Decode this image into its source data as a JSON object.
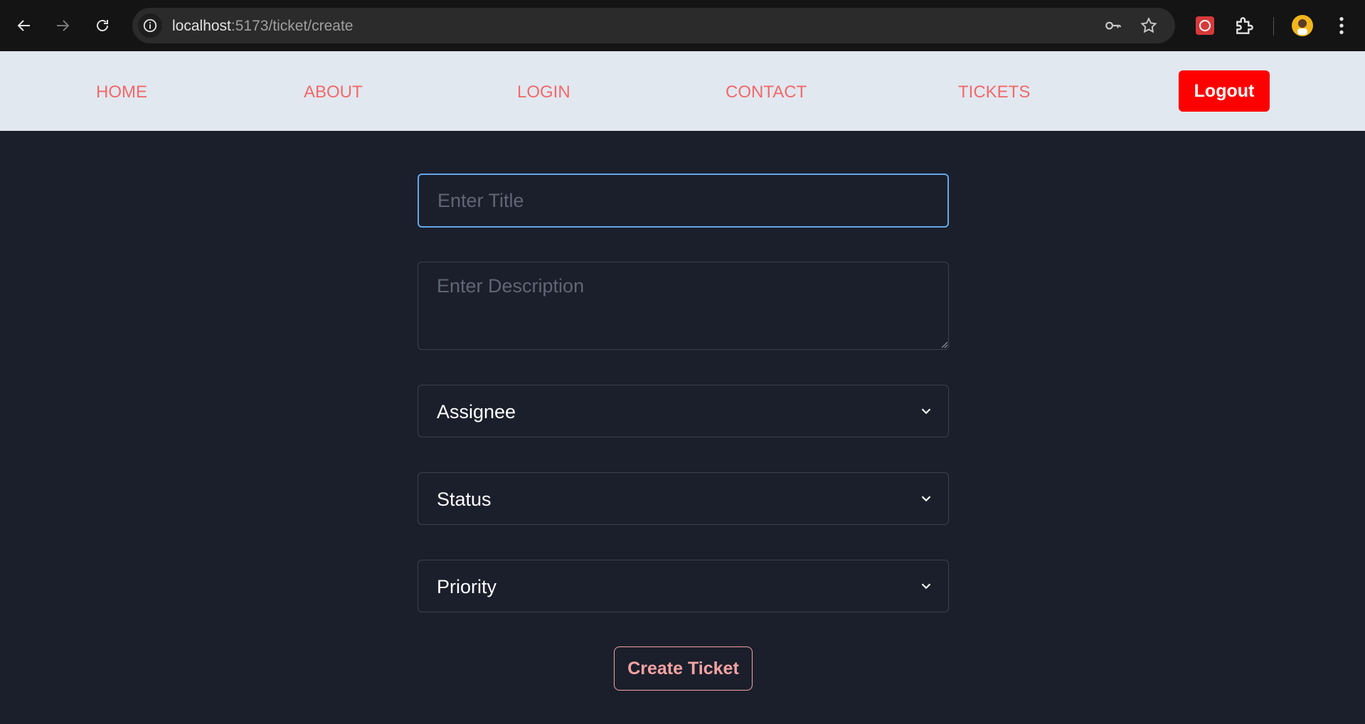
{
  "browser": {
    "url_host": "localhost",
    "url_path": ":5173/ticket/create"
  },
  "navbar": {
    "links": [
      {
        "label": "HOME"
      },
      {
        "label": "ABOUT"
      },
      {
        "label": "LOGIN"
      },
      {
        "label": "CONTACT"
      },
      {
        "label": "TICKETS"
      }
    ],
    "logout_label": "Logout"
  },
  "form": {
    "title_placeholder": "Enter Title",
    "title_value": "",
    "description_placeholder": "Enter Description",
    "description_value": "",
    "assignee_label": "Assignee",
    "status_label": "Status",
    "priority_label": "Priority",
    "submit_label": "Create Ticket"
  },
  "colors": {
    "page_bg": "#1b1f2b",
    "navbar_bg": "#e2e8f0",
    "nav_link": "#f06a6a",
    "logout_bg": "#ff0000",
    "focus_border": "#5fa9ea",
    "submit_accent": "#f5a3a3"
  }
}
